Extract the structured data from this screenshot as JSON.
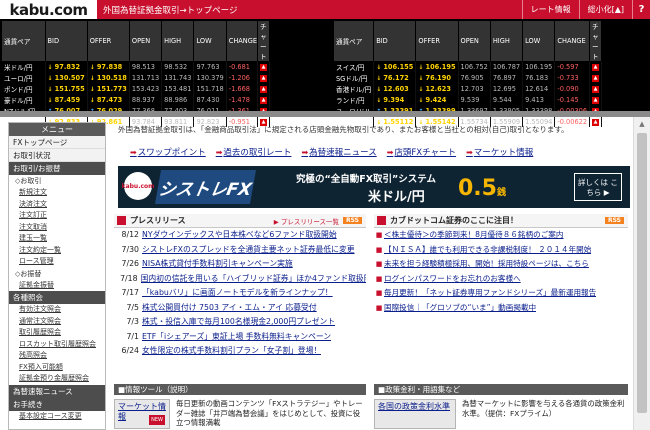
{
  "header": {
    "logo": "kabu.com",
    "title": "外国為替証拠金取引→トップページ",
    "buttons": [
      "レート情報",
      "総小化[▲]"
    ],
    "help": "?"
  },
  "rates": {
    "columns": [
      "通貨ペア",
      "BID",
      "OFFER",
      "OPEN",
      "HIGH",
      "LOW",
      "CHANGE",
      "チャート"
    ],
    "left": [
      {
        "pair": "米ドル/円",
        "dir_bid": "down",
        "bid": "97.832",
        "dir_offer": "down",
        "offer": "97.838",
        "open": "98.513",
        "high": "98.532",
        "low": "97.763",
        "change": "-0.681"
      },
      {
        "pair": "ユーロ/円",
        "dir_bid": "down",
        "bid": "130.507",
        "dir_offer": "down",
        "offer": "130.518",
        "open": "131.713",
        "high": "131.743",
        "low": "130.379",
        "change": "-1.206"
      },
      {
        "pair": "ポンド/円",
        "dir_bid": "down",
        "bid": "151.755",
        "dir_offer": "down",
        "offer": "151.773",
        "open": "153.423",
        "high": "153.481",
        "low": "151.718",
        "change": "-1.668"
      },
      {
        "pair": "豪ドル/円",
        "dir_bid": "down",
        "bid": "87.459",
        "dir_offer": "down",
        "offer": "87.473",
        "open": "88.937",
        "high": "88.986",
        "low": "87.430",
        "change": "-1.478"
      },
      {
        "pair": "NZドル/円",
        "dir_bid": "up",
        "bid": "76.007",
        "dir_offer": "up",
        "offer": "76.029",
        "open": "77.368",
        "high": "77.403",
        "low": "76.011",
        "change": "-1.361"
      },
      {
        "pair": "加ドル/円",
        "dir_bid": "down",
        "bid": "92.833",
        "dir_offer": "down",
        "offer": "92.861",
        "open": "93.784",
        "high": "93.811",
        "low": "92.823",
        "change": "-0.951"
      }
    ],
    "right": [
      {
        "pair": "スイス/円",
        "dir_bid": "down",
        "bid": "106.155",
        "dir_offer": "down",
        "offer": "106.195",
        "open": "106.752",
        "high": "106.787",
        "low": "106.195",
        "change": "-0.597"
      },
      {
        "pair": "SGドル/円",
        "dir_bid": "down",
        "bid": "76.172",
        "dir_offer": "down",
        "offer": "76.190",
        "open": "76.905",
        "high": "76.897",
        "low": "76.183",
        "change": "-0.733"
      },
      {
        "pair": "香港ドル/円",
        "dir_bid": "down",
        "bid": "12.603",
        "dir_offer": "down",
        "offer": "12.623",
        "open": "12.703",
        "high": "12.695",
        "low": "12.614",
        "change": "-0.090"
      },
      {
        "pair": "ランド/円",
        "dir_bid": "down",
        "bid": "9.394",
        "dir_offer": "down",
        "offer": "9.424",
        "open": "9.539",
        "high": "9.544",
        "low": "9.413",
        "change": "-0.145"
      },
      {
        "pair": "ユーロ/ドル",
        "dir_bid": "up",
        "bid": "1.33391",
        "dir_offer": "up",
        "offer": "1.33399",
        "open": "1.33697",
        "high": "1.33905",
        "low": "1.33398",
        "change": "-0.00306"
      },
      {
        "pair": "ポンド/ドル",
        "dir_bid": "down",
        "bid": "1.55112",
        "dir_offer": "down",
        "offer": "1.55142",
        "open": "1.55734",
        "high": "1.55909",
        "low": "1.55094",
        "change": "-0.00622"
      }
    ]
  },
  "sidebar": {
    "head": "メニュー",
    "items": [
      "FXトップページ",
      "お取引状況",
      "お取引/お振替"
    ],
    "trade_sub_head": "◇お取引",
    "trade_links": [
      "新規注文",
      "決済注文",
      "注文訂正",
      "注文取消",
      "建玉一覧",
      "注文約定一覧",
      "ロース管理"
    ],
    "transfer_sub": "◇お振替",
    "transfer_links": [
      "証拠金振替"
    ],
    "group2": "各種照会",
    "inquiry_links": [
      "有効注文照会",
      "通常注文照会",
      "取引履歴照会",
      "ロスカット取引履歴照会",
      "残高照会",
      "FX預入可能額",
      "証拠金預り金履歴照会"
    ],
    "group3": "為替速報ニュース",
    "group4": "お手続き",
    "last_link": "基本設定コース変更"
  },
  "main": {
    "notice": "外国為替証拠金取引は、「金融商品取引法」に規定される店頭金融先物取引であり、またお客様と当社との相対(自己)取引となります。",
    "nav": [
      "スワップポイント",
      "過去の取引レート",
      "為替速報ニュース",
      "店頭FXチャート",
      "マーケット情報"
    ],
    "banner": {
      "logo": "kabu.com",
      "sys": "シストレFX",
      "copy": "究極の“全自動FX取引”システム",
      "pair": "米ドル/円",
      "spread": "0.5",
      "unit": "銭",
      "more": "詳しくは こちら ▶"
    },
    "press": {
      "title": "プレスリリース",
      "caption": "▶ プレスリリース一覧",
      "rss": "RSS",
      "rows": [
        {
          "date": "8/12",
          "title": "NYダウインデックスや日本株ベなど6ファンド取扱開始"
        },
        {
          "date": "7/30",
          "title": "シストレFXのスプレッドを全通貨主要ネット証券最低に変更"
        },
        {
          "date": "7/26",
          "title": "NISA株式貸付手数料割引キャンペーン実施"
        },
        {
          "date": "7/18",
          "title": "国内初の信託を用いる「ハイブリッド証券」ほか4ファンド取扱開始"
        },
        {
          "date": "7/17",
          "title": "「kabuバリ」に画面ノートモデルを新ラインナップ！"
        },
        {
          "date": "7/5",
          "title": "株式公開買付け 7503 アイ・エム・アイ 応募受付"
        },
        {
          "date": "7/3",
          "title": "株式・投信入庫で毎月100名様現金2,000円プレゼント"
        },
        {
          "date": "7/1",
          "title": "ETF「iシェアーズ」東証上場 手数料無料キャンペーン"
        },
        {
          "date": "6/24",
          "title": "女性限定の株式手数料割引プラン「女子割」登場！"
        }
      ]
    },
    "campaign": {
      "title": "カブドットコム証券のここに注目！",
      "rss": "RSS",
      "rows": [
        "＜株主優待＞の季節到来！8月優待８６銘柄のご案内",
        "【ＮＩＳＡ】誰でも利用できる非課税制度！ ２０１４年開始",
        "未来を担う経験積極採用、開始！採用特設ページは、こちら",
        "ログインパスワードをお忘れのお客様へ",
        "毎月更新！「ネット証券専用ファンドシリーズ」最新運用報告",
        "国際投信｜「グロソブの“いま”」動画掲載中"
      ]
    },
    "sec1": {
      "head": "■情報ツール（説明）",
      "tile": "マーケット情報",
      "badge": "NEW",
      "desc": "毎日更新の動画コンテンツ「FXストラテジー」やトレーダー雑誌「井戸端為替会議」をはじめとして、投資に役立つ情報満載"
    },
    "sec2": {
      "head": "■政策金利・用語集など",
      "tile": "各国の政策金利水準",
      "desc": "為替マーケットに影響を与える各通貨の政策金利水準。（提供：FXプライム）"
    }
  }
}
